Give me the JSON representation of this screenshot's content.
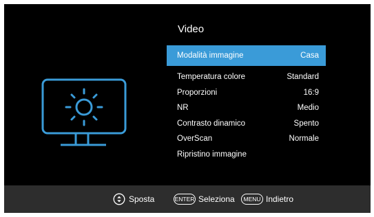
{
  "menu": {
    "title": "Video",
    "items": [
      {
        "label": "Modalità immagine",
        "value": "Casa",
        "selected": true
      },
      {
        "label": "Temperatura colore",
        "value": "Standard"
      },
      {
        "label": "Proporzioni",
        "value": "16:9"
      },
      {
        "label": "NR",
        "value": "Medio"
      },
      {
        "label": "Contrasto dinamico",
        "value": "Spento"
      },
      {
        "label": "OverScan",
        "value": "Normale"
      },
      {
        "label": "Ripristino immagine",
        "value": ""
      }
    ]
  },
  "footer": {
    "move": {
      "icon": "dpad-updown-icon",
      "label": "Sposta"
    },
    "select": {
      "key": "ENTER",
      "label": "Seleziona"
    },
    "back": {
      "key": "MENU",
      "label": "Indietro"
    }
  },
  "colors": {
    "accent": "#3a9bd8",
    "background": "#000000",
    "footer": "#2d2d2d",
    "text": "#ffffff"
  }
}
